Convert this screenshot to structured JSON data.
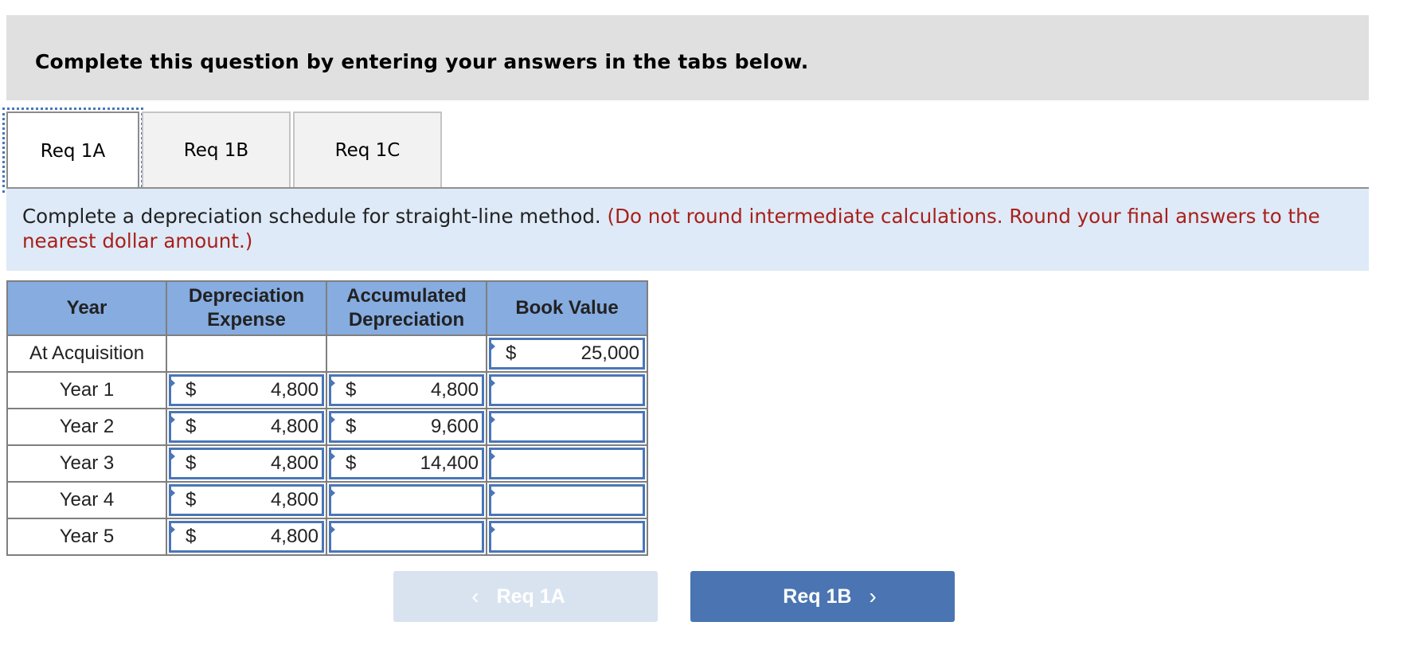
{
  "instructions": "Complete this question by entering your answers in the tabs below.",
  "tabs": [
    {
      "label": "Req 1A",
      "active": true
    },
    {
      "label": "Req 1B",
      "active": false
    },
    {
      "label": "Req 1C",
      "active": false
    }
  ],
  "prompt": {
    "text": "Complete a depreciation schedule for straight-line method.",
    "note": "(Do not round intermediate calculations. Round your final answers to the nearest dollar amount.)"
  },
  "table": {
    "headers": [
      "Year",
      "Depreciation Expense",
      "Accumulated Depreciation",
      "Book Value"
    ],
    "currency_symbol": "$",
    "rows": [
      {
        "year": "At Acquisition",
        "depreciation_expense": null,
        "accumulated_depreciation": null,
        "book_value": "25,000"
      },
      {
        "year": "Year 1",
        "depreciation_expense": "4,800",
        "accumulated_depreciation": "4,800",
        "book_value": ""
      },
      {
        "year": "Year 2",
        "depreciation_expense": "4,800",
        "accumulated_depreciation": "9,600",
        "book_value": ""
      },
      {
        "year": "Year 3",
        "depreciation_expense": "4,800",
        "accumulated_depreciation": "14,400",
        "book_value": ""
      },
      {
        "year": "Year 4",
        "depreciation_expense": "4,800",
        "accumulated_depreciation": "",
        "book_value": ""
      },
      {
        "year": "Year 5",
        "depreciation_expense": "4,800",
        "accumulated_depreciation": "",
        "book_value": ""
      }
    ]
  },
  "nav": {
    "prev_label": "Req 1A",
    "next_label": "Req 1B",
    "prev_icon": "chevron-left-icon",
    "next_icon": "chevron-right-icon"
  },
  "colors": {
    "accent": "#4a75b2",
    "header_bg": "#86ace0",
    "prompt_bg": "#deeaf7",
    "note_red": "#a8201a"
  }
}
